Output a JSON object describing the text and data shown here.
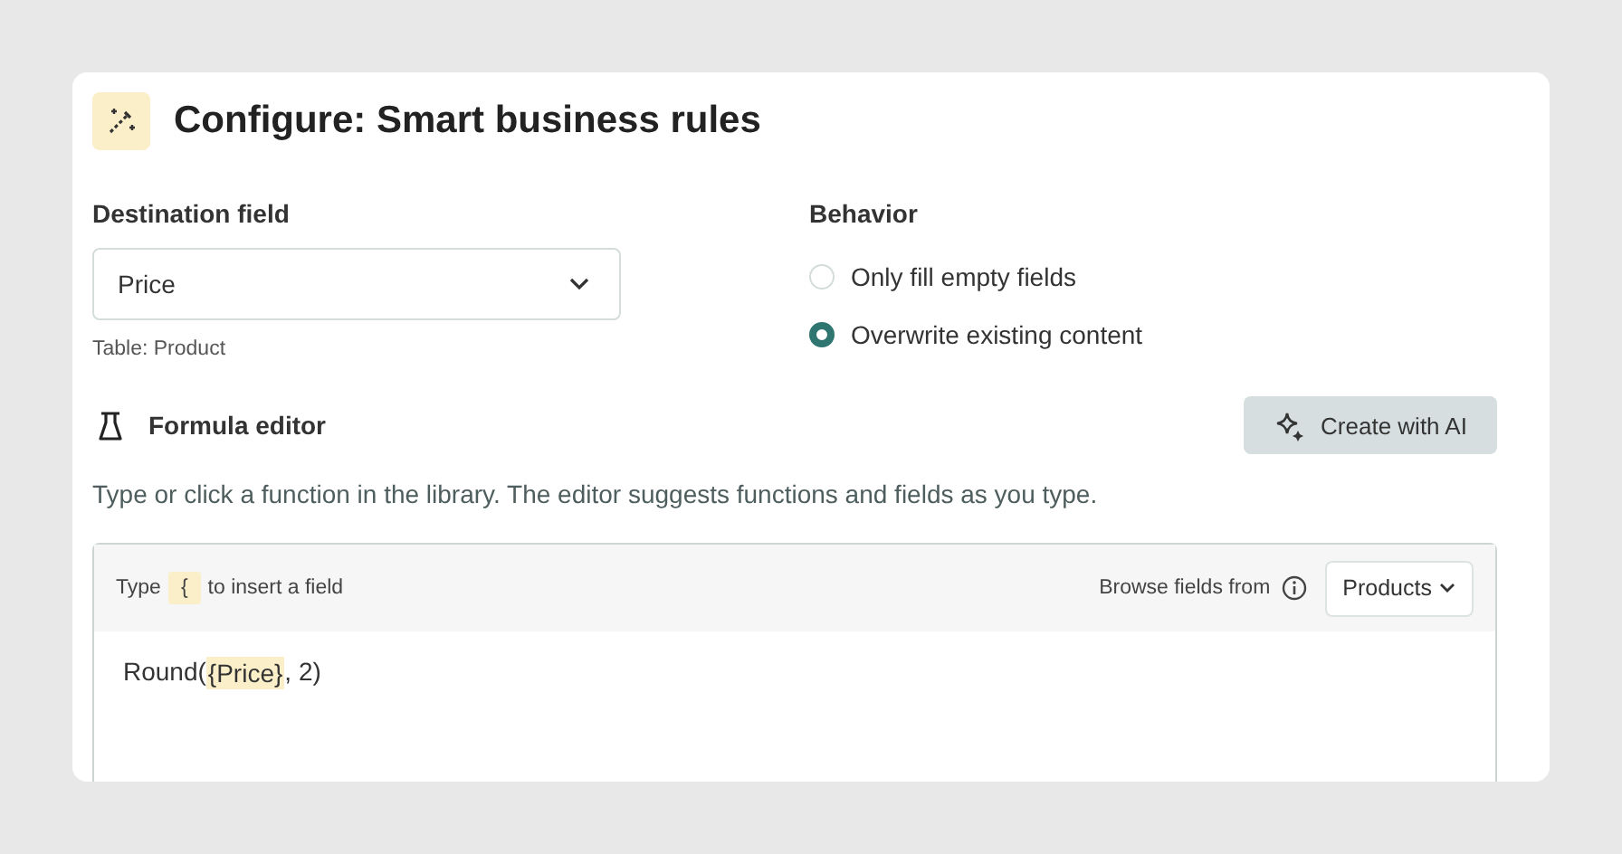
{
  "title": "Configure: Smart business rules",
  "destination": {
    "label": "Destination field",
    "value": "Price",
    "note": "Table: Product"
  },
  "behavior": {
    "label": "Behavior",
    "options": [
      {
        "label": "Only fill empty fields",
        "selected": false
      },
      {
        "label": "Overwrite existing content",
        "selected": true
      }
    ]
  },
  "formula_editor": {
    "heading": "Formula editor",
    "ai_button": "Create with AI",
    "description": "Type or click a function in the library. The editor suggests functions and fields as you type.",
    "hint": [
      {
        "kind": "text",
        "text": "Type"
      },
      {
        "kind": "key",
        "text": "{"
      },
      {
        "kind": "text",
        "text": "to insert a field"
      }
    ],
    "browse_label": "Browse fields from",
    "browse_value": "Products",
    "formula": [
      {
        "kind": "text",
        "text": "Round("
      },
      {
        "kind": "field",
        "text": "{Price}"
      },
      {
        "kind": "text",
        "text": ", 2)"
      }
    ]
  }
}
